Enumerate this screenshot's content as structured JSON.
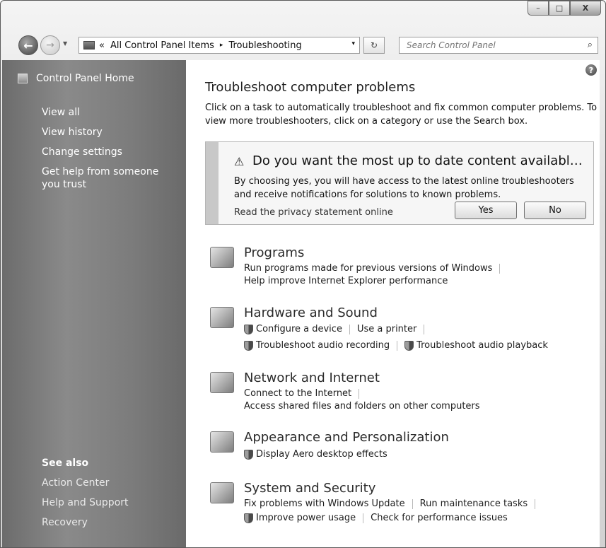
{
  "window": {
    "minimize": "–",
    "maximize": "□",
    "close": "X"
  },
  "nav": {
    "address": {
      "root": "«",
      "segment1": "All Control Panel Items",
      "separator": "▸",
      "segment2": "Troubleshooting",
      "dropdown": "▾"
    },
    "refresh": "↻",
    "search_placeholder": "Search Control Panel",
    "search_icon": "⌕"
  },
  "sidebar": {
    "home": "Control Panel Home",
    "links": [
      "View all",
      "View history",
      "Change settings",
      "Get help from someone you trust"
    ],
    "see_also_header": "See also",
    "see_also": [
      "Action Center",
      "Help and Support",
      "Recovery"
    ]
  },
  "main": {
    "title": "Troubleshoot computer problems",
    "intro": "Click on a task to automatically troubleshoot and fix common computer problems. To view more troubleshooters, click on a category or use the Search box.",
    "banner": {
      "warning_glyph": "⚠",
      "question": "Do you want the most up to date content available for tr...",
      "description": "By choosing yes, you will have access to the latest online troubleshooters and receive notifications for solutions to known problems.",
      "privacy_link": "Read the privacy statement online",
      "yes": "Yes",
      "no": "No"
    },
    "categories": {
      "programs": {
        "title": "Programs",
        "task1": "Run programs made for previous versions of Windows",
        "task2": "Help improve Internet Explorer performance"
      },
      "hardware": {
        "title": "Hardware and Sound",
        "task1": "Configure a device",
        "task2": "Use a printer",
        "task3": "Troubleshoot audio recording",
        "task4": "Troubleshoot audio playback"
      },
      "network": {
        "title": "Network and Internet",
        "task1": "Connect to the Internet",
        "task2": "Access shared files and folders on other computers"
      },
      "appearance": {
        "title": "Appearance and Personalization",
        "task1": "Display Aero desktop effects"
      },
      "system": {
        "title": "System and Security",
        "task1": "Fix problems with Windows Update",
        "task2": "Run maintenance tasks",
        "task3": "Improve power usage",
        "task4": "Check for performance issues"
      }
    }
  }
}
